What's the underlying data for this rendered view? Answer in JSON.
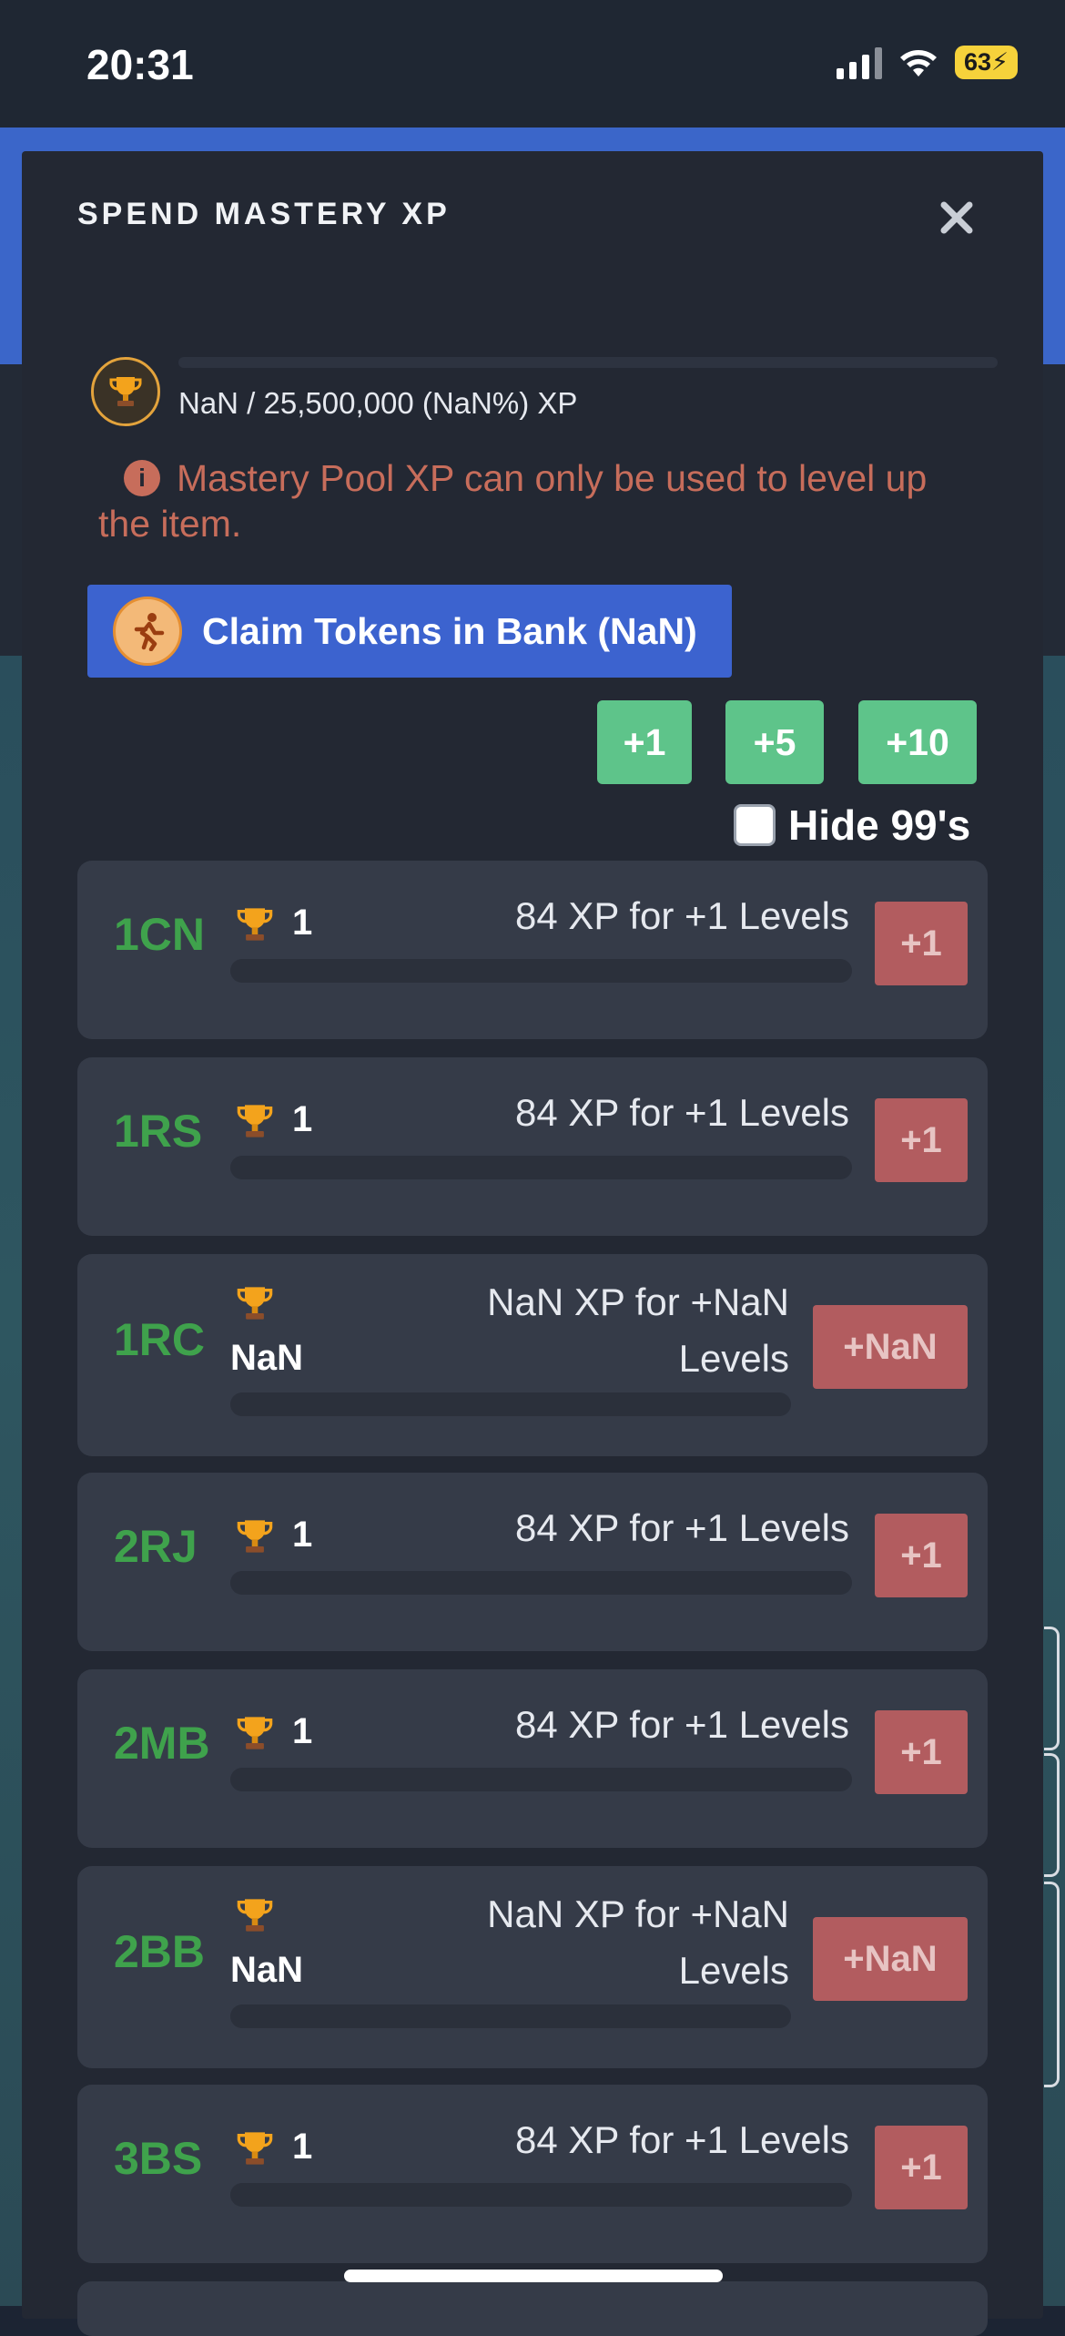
{
  "status_bar": {
    "time": "20:31",
    "battery": "63"
  },
  "modal": {
    "title": "SPEND MASTERY XP",
    "close_symbol": "✕",
    "pool": {
      "text": "NaN / 25,500,000 (NaN%) XP",
      "progress_fraction": 0
    },
    "alert": {
      "icon_glyph": "i",
      "text": "Mastery Pool XP can only be used to level up the item."
    },
    "claim_button": {
      "label": "Claim Tokens in Bank (NaN)"
    },
    "increments": [
      "+1",
      "+5",
      "+10"
    ],
    "hide_99": {
      "label": "Hide 99's",
      "checked": false
    },
    "items": [
      {
        "name": "1CN",
        "level": "1",
        "xp_line1": "84 XP for +1 Levels",
        "xp_line2": "",
        "button": "+1"
      },
      {
        "name": "1RS",
        "level": "1",
        "xp_line1": "84 XP for +1 Levels",
        "xp_line2": "",
        "button": "+1"
      },
      {
        "name": "1RC",
        "level": "NaN",
        "xp_line1": "NaN XP for +NaN",
        "xp_line2": "Levels",
        "button": "+NaN"
      },
      {
        "name": "2RJ",
        "level": "1",
        "xp_line1": "84 XP for +1 Levels",
        "xp_line2": "",
        "button": "+1"
      },
      {
        "name": "2MB",
        "level": "1",
        "xp_line1": "84 XP for +1 Levels",
        "xp_line2": "",
        "button": "+1"
      },
      {
        "name": "2BB",
        "level": "NaN",
        "xp_line1": "NaN XP for +NaN",
        "xp_line2": "Levels",
        "button": "+NaN"
      },
      {
        "name": "3BS",
        "level": "1",
        "xp_line1": "84 XP for +1 Levels",
        "xp_line2": "",
        "button": "+1"
      }
    ]
  },
  "colors": {
    "accent_blue": "#3c63cf",
    "green_button": "#5ec48a",
    "red_button": "#b25c5f",
    "item_name_green": "#3fa24c",
    "alert_text": "#c76d5b"
  },
  "icons": {
    "close": "close-icon",
    "pool": "trophy-icon",
    "alert": "info-icon",
    "claim": "running-person-icon",
    "item": "trophy-icon"
  }
}
